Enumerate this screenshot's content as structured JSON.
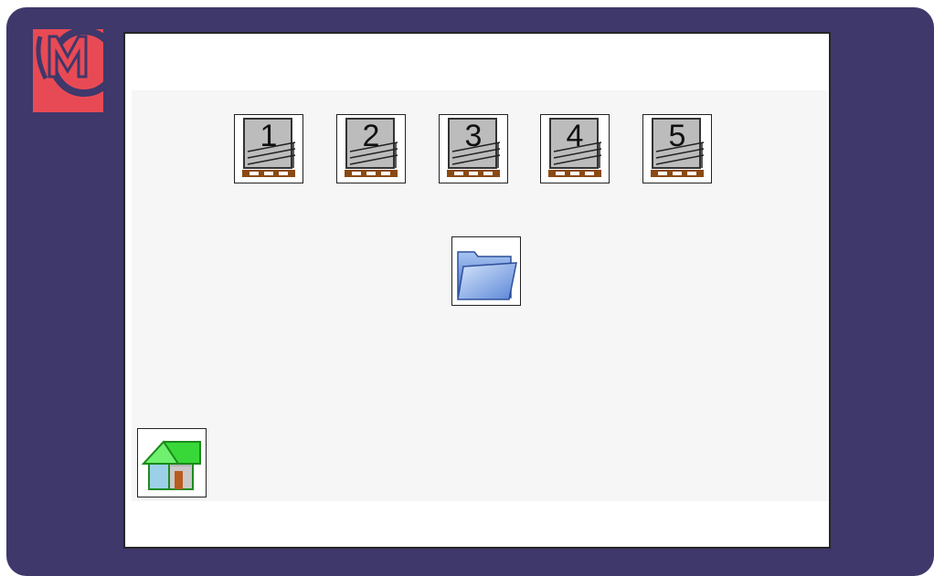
{
  "brand": {
    "logo_name": "cm-logo",
    "accent": "#e84a55",
    "bezel": "#3e386b"
  },
  "program_buttons": [
    {
      "label": "1",
      "icon": "rack-pallet-icon"
    },
    {
      "label": "2",
      "icon": "rack-pallet-icon"
    },
    {
      "label": "3",
      "icon": "rack-pallet-icon"
    },
    {
      "label": "4",
      "icon": "rack-pallet-icon"
    },
    {
      "label": "5",
      "icon": "rack-pallet-icon"
    }
  ],
  "folder_button": {
    "icon": "folder-icon"
  },
  "home_button": {
    "icon": "home-icon"
  }
}
